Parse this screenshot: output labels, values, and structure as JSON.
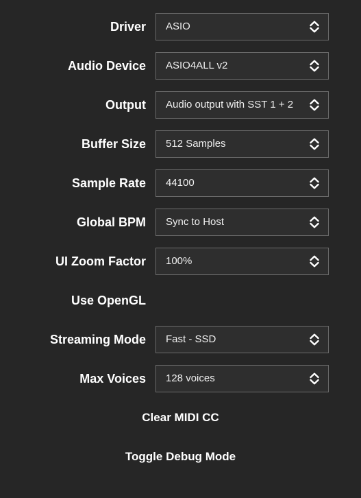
{
  "settings": {
    "driver": {
      "label": "Driver",
      "value": "ASIO"
    },
    "audio_device": {
      "label": "Audio Device",
      "value": "ASIO4ALL v2"
    },
    "output": {
      "label": "Output",
      "value": "Audio output with SST 1 + 2"
    },
    "buffer_size": {
      "label": "Buffer Size",
      "value": "512 Samples"
    },
    "sample_rate": {
      "label": "Sample Rate",
      "value": "44100"
    },
    "global_bpm": {
      "label": "Global BPM",
      "value": "Sync to Host"
    },
    "ui_zoom": {
      "label": "UI Zoom Factor",
      "value": "100%"
    },
    "use_opengl": {
      "label": "Use OpenGL"
    },
    "streaming_mode": {
      "label": "Streaming Mode",
      "value": "Fast - SSD"
    },
    "max_voices": {
      "label": "Max Voices",
      "value": "128 voices"
    }
  },
  "actions": {
    "clear_midi_cc": "Clear MIDI CC",
    "toggle_debug": "Toggle Debug Mode"
  },
  "icons": {
    "select_arrows": "up-down-chevron-icon"
  },
  "colors": {
    "background": "#262626",
    "field_border": "#6b6b6b",
    "text": "#ffffff"
  }
}
